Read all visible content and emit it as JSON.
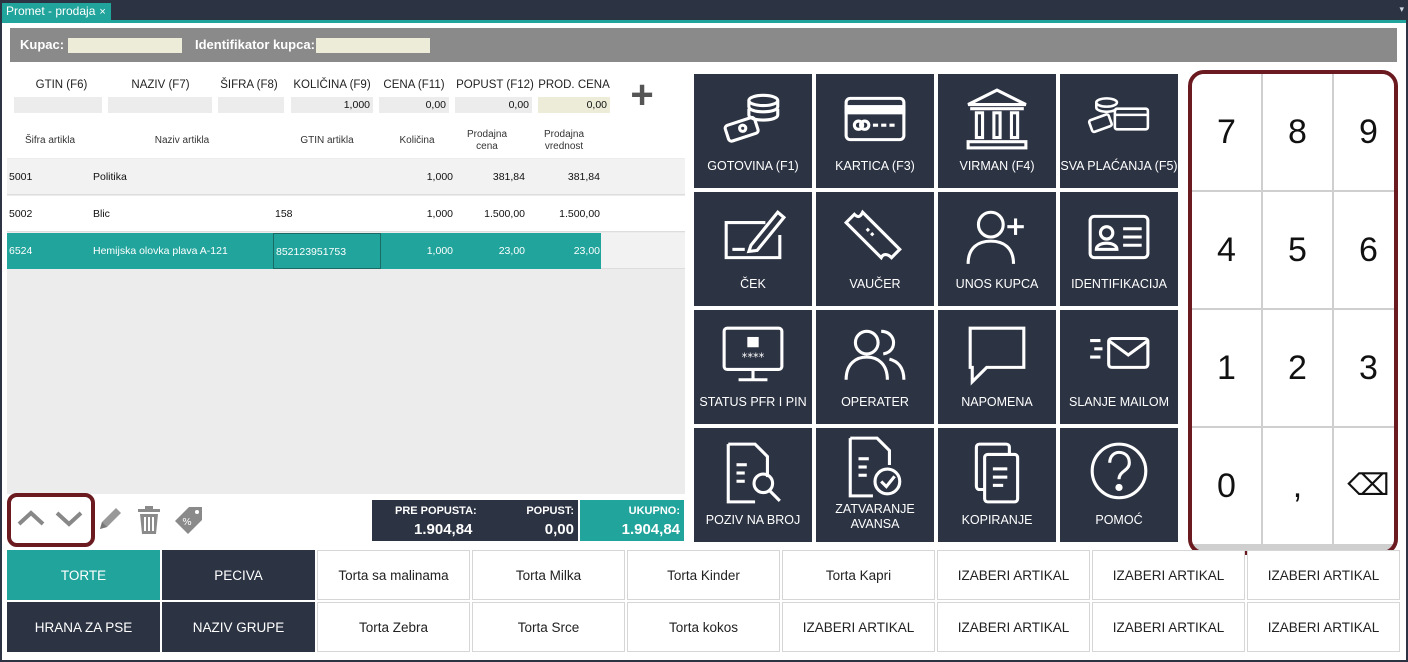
{
  "tab": {
    "title": "Promet - prodaja",
    "close": "×",
    "menu": "▾"
  },
  "customer": {
    "label": "Kupac:",
    "value": "",
    "id_label": "Identifikator kupca:",
    "id_value": ""
  },
  "entry": {
    "headers": [
      "GTIN (F6)",
      "NAZIV (F7)",
      "ŠIFRA (F8)",
      "KOLIČINA (F9)",
      "CENA (F11)",
      "POPUST (F12)",
      "PROD. CENA"
    ],
    "values": [
      "",
      "",
      "",
      "1,000",
      "0,00",
      "0,00",
      "0,00"
    ],
    "add": "+"
  },
  "table": {
    "headers": [
      "Šifra artikla",
      "Naziv artikla",
      "GTIN artikla",
      "Količina",
      "Prodajna cena",
      "Prodajna vrednost"
    ],
    "rows": [
      {
        "sifra": "5001",
        "naziv": "Politika",
        "gtin": "",
        "kolicina": "1,000",
        "cena": "381,84",
        "vrednost": "381,84"
      },
      {
        "sifra": "5002",
        "naziv": "Blic",
        "gtin": "158",
        "kolicina": "1,000",
        "cena": "1.500,00",
        "vrednost": "1.500,00"
      },
      {
        "sifra": "6524",
        "naziv": "Hemijska olovka plava A-121",
        "gtin": "852123951753",
        "kolicina": "1,000",
        "cena": "23,00",
        "vrednost": "23,00"
      }
    ]
  },
  "totals": {
    "pre_label": "PRE POPUSTA:",
    "pre_value": "1.904,84",
    "popust_label": "POPUST:",
    "popust_value": "0,00",
    "ukupno_label": "UKUPNO:",
    "ukupno_value": "1.904,84"
  },
  "actions": [
    {
      "label": "GOTOVINA (F1)",
      "icon": "cash-icon"
    },
    {
      "label": "KARTICA (F3)",
      "icon": "card-icon"
    },
    {
      "label": "VIRMAN (F4)",
      "icon": "bank-icon"
    },
    {
      "label": "SVA PLAĆANJA (F5)",
      "icon": "all-payments-icon"
    },
    {
      "label": "ČEK",
      "icon": "check-icon"
    },
    {
      "label": "VAUČER",
      "icon": "voucher-icon"
    },
    {
      "label": "UNOS KUPCA",
      "icon": "add-customer-icon"
    },
    {
      "label": "IDENTIFIKACIJA",
      "icon": "id-card-icon"
    },
    {
      "label": "STATUS PFR I PIN",
      "icon": "monitor-lock-icon"
    },
    {
      "label": "OPERATER",
      "icon": "users-icon"
    },
    {
      "label": "NAPOMENA",
      "icon": "note-icon"
    },
    {
      "label": "SLANJE MAILOM",
      "icon": "mail-icon"
    },
    {
      "label": "POZIV NA BROJ",
      "icon": "doc-search-icon"
    },
    {
      "label": "ZATVARANJE AVANSA",
      "icon": "doc-check-icon"
    },
    {
      "label": "KOPIRANJE",
      "icon": "copy-icon"
    },
    {
      "label": "POMOĆ",
      "icon": "help-icon"
    }
  ],
  "numpad": [
    "7",
    "8",
    "9",
    "4",
    "5",
    "6",
    "1",
    "2",
    "3",
    "0",
    ",",
    "⌫"
  ],
  "groups": [
    {
      "label": "TORTE",
      "style": "teal"
    },
    {
      "label": "PECIVA",
      "style": "dark"
    },
    {
      "label": "Torta sa malinama",
      "style": "plain"
    },
    {
      "label": "Torta Milka",
      "style": "plain"
    },
    {
      "label": "Torta Kinder",
      "style": "plain"
    },
    {
      "label": "Torta Kapri",
      "style": "plain"
    },
    {
      "label": "IZABERI ARTIKAL",
      "style": "plain"
    },
    {
      "label": "IZABERI ARTIKAL",
      "style": "plain"
    },
    {
      "label": "IZABERI ARTIKAL",
      "style": "plain"
    },
    {
      "label": "HRANA ZA PSE",
      "style": "dark"
    },
    {
      "label": "NAZIV GRUPE",
      "style": "dark"
    },
    {
      "label": "Torta Zebra",
      "style": "plain"
    },
    {
      "label": "Torta Srce",
      "style": "plain"
    },
    {
      "label": "Torta kokos",
      "style": "plain"
    },
    {
      "label": "IZABERI ARTIKAL",
      "style": "plain"
    },
    {
      "label": "IZABERI ARTIKAL",
      "style": "plain"
    },
    {
      "label": "IZABERI ARTIKAL",
      "style": "plain"
    },
    {
      "label": "IZABERI ARTIKAL",
      "style": "plain"
    }
  ],
  "colors": {
    "teal": "#21a49c",
    "navy": "#2c3343",
    "highlight": "#6b1a1f"
  }
}
